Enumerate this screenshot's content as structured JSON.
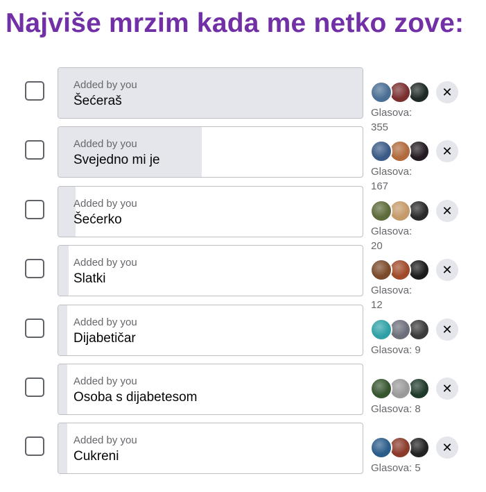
{
  "title": "Najviše mrzim kada me netko zove:",
  "icons": {
    "checkbox": "checkbox-icon",
    "remove": "close-icon",
    "avatar": "user-avatar"
  },
  "colors": {
    "title": "#7230a6",
    "bar_fill": "#e4e6eb",
    "border": "#bcc0c4"
  },
  "options": [
    {
      "added_by": "Added by you",
      "label": "Šećeraš",
      "votes_text": "Glasova: 355",
      "votes": 355,
      "avatar_colors": [
        "#4a6f94",
        "#7a2f2f",
        "#1f2a26"
      ]
    },
    {
      "added_by": "Added by you",
      "label": "Svejedno mi je",
      "votes_text": "Glasova: 167",
      "votes": 167,
      "avatar_colors": [
        "#3b5b86",
        "#b06a3c",
        "#241c22"
      ]
    },
    {
      "added_by": "Added by you",
      "label": "Šećerko",
      "votes_text": "Glasova: 20",
      "votes": 20,
      "avatar_colors": [
        "#5d6a3a",
        "#c59a6a",
        "#2a2a2a"
      ]
    },
    {
      "added_by": "Added by you",
      "label": "Slatki",
      "votes_text": "Glasova: 12",
      "votes": 12,
      "avatar_colors": [
        "#7a4a2a",
        "#a04a2a",
        "#1c1c1c"
      ]
    },
    {
      "added_by": "Added by you",
      "label": "Dijabetičar",
      "votes_text": "Glasova: 9",
      "votes": 9,
      "avatar_colors": [
        "#2fa1a6",
        "#6c6f7a",
        "#3b3b3b"
      ]
    },
    {
      "added_by": "Added by you",
      "label": "Osoba s dijabetesom",
      "votes_text": "Glasova: 8",
      "votes": 8,
      "avatar_colors": [
        "#37552f",
        "#9a9a9a",
        "#1f3a2a"
      ]
    },
    {
      "added_by": "Added by you",
      "label": "Cukreni",
      "votes_text": "Glasova: 5",
      "votes": 5,
      "avatar_colors": [
        "#2b5c8a",
        "#8a3a2a",
        "#222222"
      ]
    }
  ]
}
